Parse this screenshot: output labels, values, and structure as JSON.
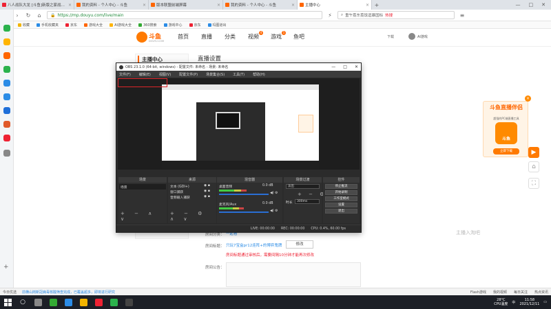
{
  "browser": {
    "tabs": [
      {
        "label": "八人战队大龙  [斗鱼]新版之家战队第...",
        "icon_color": "#e23",
        "active": false
      },
      {
        "label": "我的资料 - 个人中心 - 斗鱼",
        "icon_color": "#f60",
        "active": false
      },
      {
        "label": "版本联盟前端屏幕",
        "icon_color": "#f60",
        "active": false
      },
      {
        "label": "我的资料 - 个人中心 - 斗鱼",
        "icon_color": "#f60",
        "active": false
      },
      {
        "label": "主播中心",
        "icon_color": "#f60",
        "active": true
      }
    ],
    "tab_close": "×",
    "new_tab": "+",
    "window_controls": {
      "min": "—",
      "max": "□",
      "close": "✕"
    },
    "url": "https://mp.douyu.com/live/main",
    "url_lock": "🔒",
    "search_placeholder": "重午荔东荔饭逗暴国标",
    "search_hot": "热搜",
    "bookmarks": [
      {
        "label": "收藏",
        "color": "#f2b400"
      },
      {
        "label": "手机收藏夹",
        "color": "#2b8ce6"
      },
      {
        "label": "京东",
        "color": "#e23"
      },
      {
        "label": "游戏大全",
        "color": "#f60"
      },
      {
        "label": "AI游戏大全",
        "color": "#ffb400"
      },
      {
        "label": "360搜索",
        "color": "#3a3"
      },
      {
        "label": "游戏中心",
        "color": "#2b8ce6"
      },
      {
        "label": "京东",
        "color": "#e23"
      },
      {
        "label": "玛图道出",
        "color": "#2b8ce6"
      }
    ],
    "sidebar_icon_colors": [
      "#2bb24c",
      "#ffb400",
      "#f60",
      "#2bb24c",
      "#2b8ce6",
      "#2b8ce6",
      "#1e6fd9",
      "#e05a2a",
      "#e23",
      "#888"
    ]
  },
  "douyu": {
    "logo_text": "斗鱼",
    "logo_sub": "DOUYU.COM",
    "nav": [
      {
        "label": "首页",
        "selected": false
      },
      {
        "label": "直播",
        "selected": false
      },
      {
        "label": "分类",
        "selected": false
      },
      {
        "label": "视频",
        "selected": false,
        "badge": "4"
      },
      {
        "label": "游戏",
        "selected": false,
        "badge": "1"
      },
      {
        "label": "鱼吧",
        "selected": false
      }
    ],
    "download": "下载",
    "username": "AI游戏",
    "menu_header": "主播中心",
    "page_title": "直播设置",
    "form": {
      "label1": "房间分类：",
      "value1": "一起看",
      "label2": "房间标题：",
      "value2": "只玩7宝盒pr12连阵+的博弈鬼牌",
      "modify_button": "修改",
      "warning": "房间标题通过审核后，需要间隔10分钟才能再次修改",
      "label3": "房间公告："
    },
    "watermark": "主播入淘吧",
    "ad": {
      "title": "斗鱼直播伴侣",
      "subtitle": "超强的PC端直播工具",
      "app_name": "斗鱼",
      "button": "立即下载",
      "close": "×"
    },
    "right_buttons": [
      "▶",
      "⌂",
      "⛶"
    ]
  },
  "obs": {
    "title": "OBS 23.1.0 (64-bit, windows) - 配置文件: 未命名 - 场景: 未命名",
    "window_controls": {
      "min": "—",
      "max": "□",
      "close": "✕"
    },
    "menu": [
      "文件(F)",
      "编辑(E)",
      "视图(V)",
      "配置文件(P)",
      "场景集合(S)",
      "工具(T)",
      "帮助(H)"
    ],
    "docks": {
      "scenes": {
        "header": "场景",
        "items": [
          "场景"
        ]
      },
      "sources": {
        "header": "来源",
        "items": [
          "文本 (GDI+)",
          "窗口捕获",
          "音频输入捕获"
        ]
      },
      "mixer": {
        "header": "混音器",
        "channels": [
          {
            "name": "桌面音频",
            "level": "0.0 dB",
            "meter": 0.55
          },
          {
            "name": "麦克风/Aux",
            "level": "0.0 dB",
            "meter": 0.5
          }
        ]
      },
      "transitions": {
        "header": "场景过渡",
        "selected": "淡出",
        "duration_label": "时长",
        "duration": "300ms"
      },
      "controls": {
        "header": "控件",
        "buttons": [
          "停止推流",
          "开始录制",
          "工作室模式",
          "设置",
          "退出"
        ]
      }
    },
    "dock_toolbar": "+ − ∧ ∨",
    "source_toolbar": "+ − ⚙ ∧ ∨",
    "status": {
      "live": "LIVE: 00:00:00",
      "rec": "REC: 00:00:00",
      "cpu": "CPU: 0.4%, 60.00 fps"
    }
  },
  "statusbar": {
    "left": "今日优选",
    "news": "前横山岗新冠病毒核酸筛查完成，已覆盖超多，即将进行研究",
    "right_items": [
      "Flash游戏",
      "我的视频",
      "每日关注",
      "热点资讯"
    ]
  },
  "taskbar": {
    "app_colors": [
      "#888",
      "#3a3",
      "#2b8ce6",
      "#f2b400",
      "#e23",
      "#2bb24c",
      "#444"
    ],
    "weather_temp": "28°C",
    "weather_text": "CPU温度",
    "lang": "中",
    "time": "11:58",
    "date": "2021/12/11"
  }
}
